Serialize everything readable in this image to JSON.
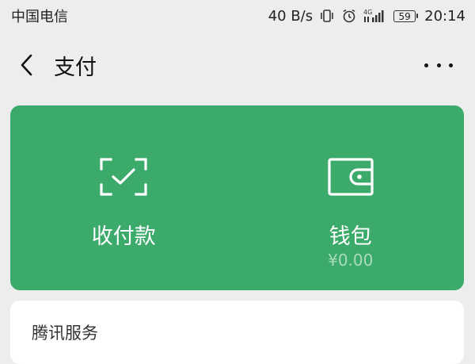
{
  "status_bar": {
    "carrier": "中国电信",
    "net_speed": "40 B/s",
    "network_type": "4G",
    "battery": "59",
    "time": "20:14",
    "icons": [
      "vibrate-icon",
      "alarm-icon",
      "signal-icon",
      "battery-icon"
    ]
  },
  "header": {
    "title": "支付",
    "back_icon": "chevron-left-icon",
    "more_icon": "more-horizontal-icon"
  },
  "pay_card": {
    "background": "#3caa6b",
    "items": [
      {
        "label": "收付款",
        "icon": "scan-check-icon"
      },
      {
        "label": "钱包",
        "icon": "wallet-icon",
        "balance": "¥0.00"
      }
    ]
  },
  "services": {
    "title": "腾讯服务"
  }
}
